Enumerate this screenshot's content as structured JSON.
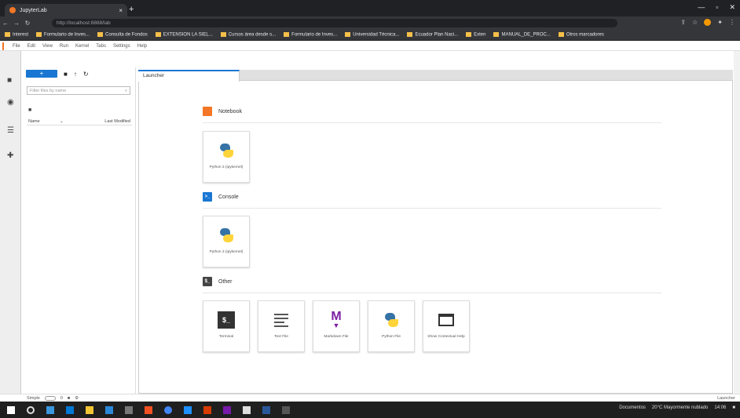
{
  "browser": {
    "tab_title": "JupyterLab",
    "tab_close": "×",
    "new_tab": "+",
    "url": "http://localhost:8888/lab",
    "bookmarks": [
      "Interest",
      "Formulario de Inves...",
      "Consulta de Fondos",
      "EXTENSION LA SIEL...",
      "Cursos área desde s...",
      "Formulario de Inves...",
      "Universidad Técnica...",
      "Ecuador Plan Naci...",
      "Exten",
      "MANUAL_DE_PROC...",
      "Otros marcadores"
    ]
  },
  "jupyter": {
    "menu": [
      "File",
      "Edit",
      "View",
      "Run",
      "Kernel",
      "Tabs",
      "Settings",
      "Help"
    ],
    "new_button": "+",
    "filter_placeholder": "Filter files by name",
    "columns": {
      "name": "Name",
      "sort": "⌄",
      "modified": "Last Modified"
    },
    "tab_label": "Launcher",
    "sections": [
      {
        "title": "Notebook",
        "color": "#f37726",
        "icon_text": ""
      },
      {
        "title": "Console",
        "color": "#1976d2",
        "icon_text": ">_"
      },
      {
        "title": "Other",
        "color": "#444444",
        "icon_text": "$_"
      }
    ],
    "notebook_cards": [
      {
        "label": "Python 3 (ipykernel)",
        "icon": "python-icon"
      }
    ],
    "console_cards": [
      {
        "label": "Python 3 (ipykernel)",
        "icon": "python-icon"
      }
    ],
    "other_cards": [
      {
        "label": "Terminal",
        "icon": "terminal-icon"
      },
      {
        "label": "Text File",
        "icon": "text-file-icon"
      },
      {
        "label": "Markdown File",
        "icon": "markdown-icon"
      },
      {
        "label": "Python File",
        "icon": "python-icon"
      },
      {
        "label": "Show Contextual Help",
        "icon": "contextual-help-icon"
      }
    ],
    "status": {
      "mode": "Simple",
      "counts": "0",
      "right": "Launcher"
    }
  },
  "taskbar": {
    "tray_text": "Documentos",
    "weather": "20°C Mayormente nublado",
    "time": "14:06"
  }
}
